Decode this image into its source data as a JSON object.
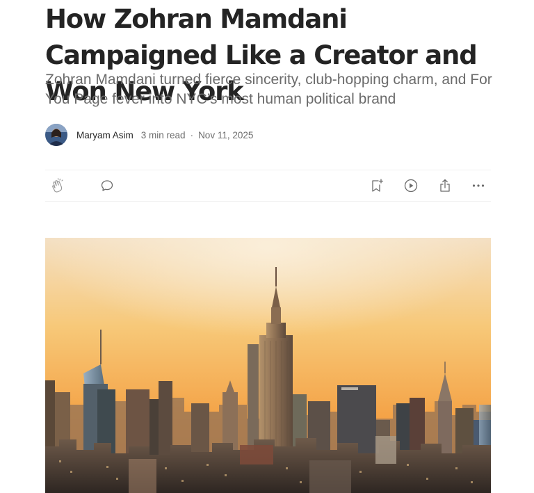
{
  "article": {
    "title": "How Zohran Mamdani Campaigned Like a Creator and Won New York",
    "subtitle": "Zohran Mamdani turned fierce sincerity, club-hopping charm, and For You Page fever into NYC’s most human political brand",
    "author": "Maryam Asim",
    "read_time": "3 min read",
    "separator": "·",
    "date": "Nov 11, 2025"
  },
  "actions": {
    "icons": [
      "clap-icon",
      "comment-icon",
      "bookmark-add-icon",
      "play-icon",
      "share-icon",
      "more-icon"
    ]
  },
  "colors": {
    "text": "#242424",
    "muted": "#6b6b6b",
    "divider": "#f0f0f0",
    "sky_top": "#f6e4c9",
    "sky_bottom": "#f39a3a"
  }
}
